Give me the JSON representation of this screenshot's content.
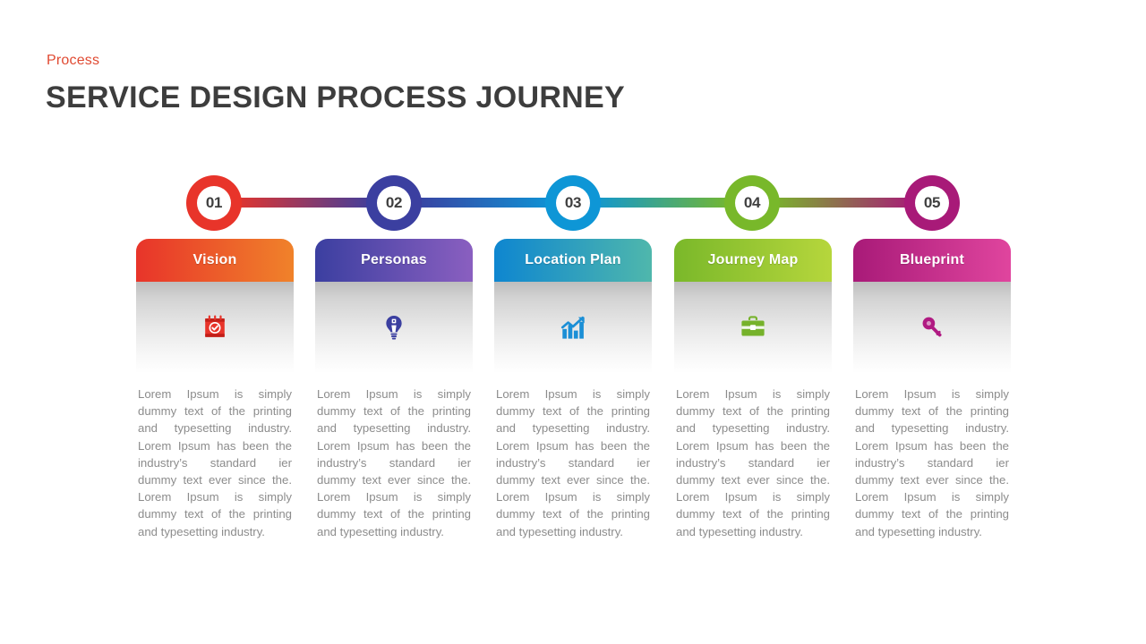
{
  "header": {
    "kicker": "Process",
    "title": "SERVICE DESIGN PROCESS JOURNEY",
    "kicker_color": "#e04a32",
    "title_color": "#3d3d3d"
  },
  "timeline": {
    "nodes": [
      {
        "number": "01",
        "color": "#e8342a"
      },
      {
        "number": "02",
        "color": "#3b3fa0"
      },
      {
        "number": "03",
        "color": "#0e96d6"
      },
      {
        "number": "04",
        "color": "#78b82a"
      },
      {
        "number": "05",
        "color": "#a81a78"
      }
    ],
    "connectors": [
      {
        "from": "#e8342a",
        "to": "#3b3fa0"
      },
      {
        "from": "#3b3fa0",
        "to": "#0e96d6"
      },
      {
        "from": "#0e96d6",
        "to": "#78b82a"
      },
      {
        "from": "#78b82a",
        "to": "#a81a78"
      }
    ]
  },
  "body_text": "Lorem Ipsum is simply dummy text of the printing and typesetting industry. Lorem Ipsum has been the industry’s standard ier dummy text ever since the. Lorem Ipsum is simply dummy text of the printing and typesetting industry.",
  "cards": [
    {
      "step": "01",
      "title": "Vision",
      "icon": "calendar-check-icon",
      "header_from": "#e8342a",
      "header_to": "#f0822a",
      "icon_color": "#e8342a",
      "text": "Lorem Ipsum is simply dummy text of the printing and typesetting industry. Lorem Ipsum has been the industry’s standard ier dummy text ever since the. Lorem Ipsum is simply dummy text of the printing and typesetting industry."
    },
    {
      "step": "02",
      "title": "Personas",
      "icon": "lightbulb-icon",
      "header_from": "#3b3fa0",
      "header_to": "#8a5fc0",
      "icon_color": "#3b3fa0",
      "text": "Lorem Ipsum is simply dummy text of the printing and typesetting industry. Lorem Ipsum has been the industry’s standard ier dummy text ever since the. Lorem Ipsum is simply dummy text of the printing and typesetting industry."
    },
    {
      "step": "03",
      "title": "Location Plan",
      "icon": "bar-chart-growth-icon",
      "header_from": "#0e86d0",
      "header_to": "#4fb7ac",
      "icon_color": "#1b8fd6",
      "text": "Lorem Ipsum is simply dummy text of the printing and typesetting industry. Lorem Ipsum has been the industry’s standard ier dummy text ever since the. Lorem Ipsum is simply dummy text of the printing and typesetting industry."
    },
    {
      "step": "04",
      "title": "Journey Map",
      "icon": "briefcase-icon",
      "header_from": "#7ab82a",
      "header_to": "#b6d63c",
      "icon_color": "#76b22b",
      "text": "Lorem Ipsum is simply dummy text of the printing and typesetting industry. Lorem Ipsum has been the industry’s standard ier dummy text ever since the. Lorem Ipsum is simply dummy text of the printing and typesetting industry."
    },
    {
      "step": "05",
      "title": "Blueprint",
      "icon": "key-icon",
      "header_from": "#a81a78",
      "header_to": "#e0459e",
      "icon_color": "#b01a82",
      "text": "Lorem Ipsum is simply dummy text of the printing and typesetting industry. Lorem Ipsum has been the industry’s standard ier dummy text ever since the. Lorem Ipsum is simply dummy text of the printing and typesetting industry."
    }
  ]
}
